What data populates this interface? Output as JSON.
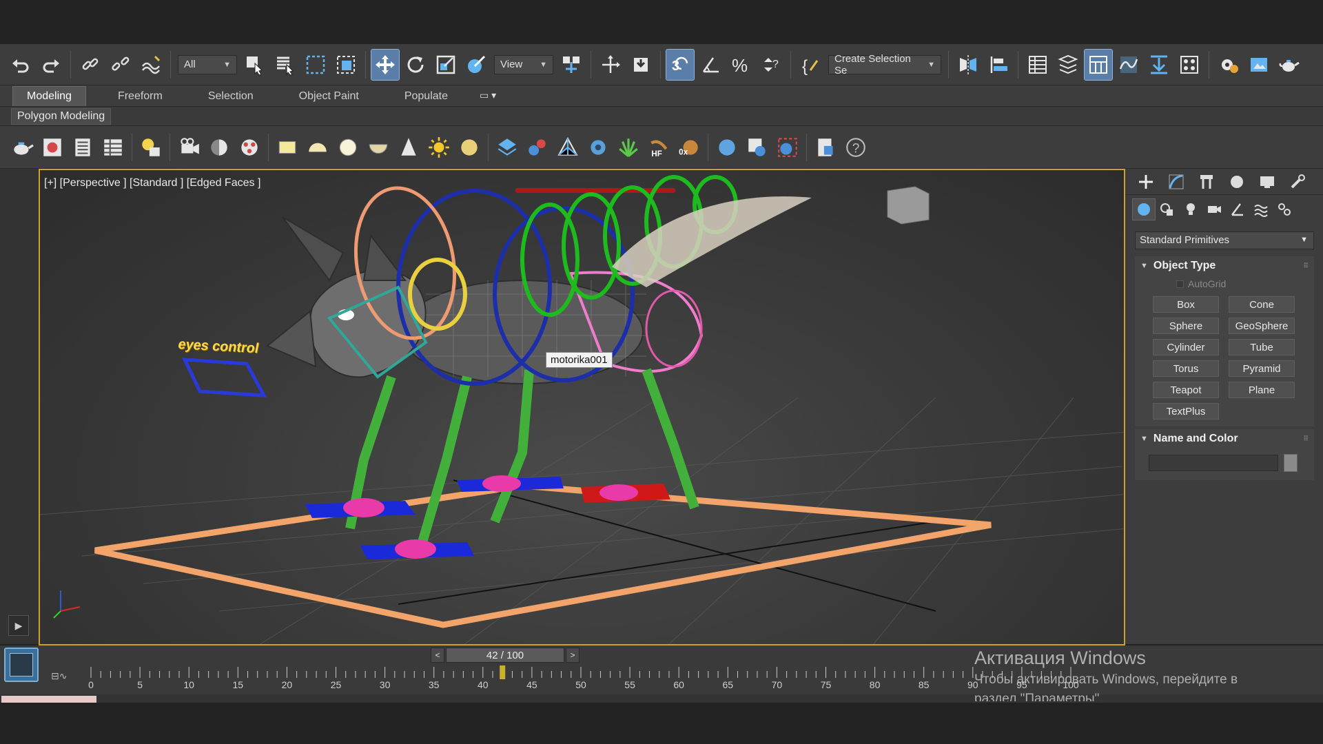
{
  "main_toolbar": {
    "selection_filter": "All",
    "reference_coord": "View",
    "named_selection": "Create Selection Se"
  },
  "ribbon": {
    "tabs": [
      {
        "label": "Modeling",
        "active": true
      },
      {
        "label": "Freeform",
        "active": false
      },
      {
        "label": "Selection",
        "active": false
      },
      {
        "label": "Object Paint",
        "active": false
      },
      {
        "label": "Populate",
        "active": false
      }
    ],
    "sub_label": "Polygon Modeling"
  },
  "viewport": {
    "label": "[+] [Perspective ] [Standard ] [Edged Faces ]",
    "tooltip": "motorika001",
    "annotation": "eyes control"
  },
  "command_panel": {
    "category_dropdown": "Standard Primitives",
    "object_type_title": "Object Type",
    "autogrid_label": "AutoGrid",
    "objects": [
      "Box",
      "Cone",
      "Sphere",
      "GeoSphere",
      "Cylinder",
      "Tube",
      "Torus",
      "Pyramid",
      "Teapot",
      "Plane",
      "TextPlus"
    ],
    "name_color_title": "Name and Color"
  },
  "timeline": {
    "frame_display": "42 / 100",
    "current_frame": 42,
    "total_frames": 100,
    "ticks": [
      "0",
      "5",
      "10",
      "15",
      "20",
      "25",
      "30",
      "35",
      "40",
      "45",
      "50",
      "55",
      "60",
      "65",
      "70",
      "75",
      "80",
      "85",
      "90",
      "95",
      "100"
    ]
  },
  "watermark": {
    "title": "Активация Windows",
    "line1": "Чтобы активировать Windows, перейдите в",
    "line2": "раздел \"Параметры\"."
  },
  "colors": {
    "viewport_border": "#c8a42c",
    "active_button": "#5a7ea8",
    "panel_bg": "#3d3d3d"
  }
}
